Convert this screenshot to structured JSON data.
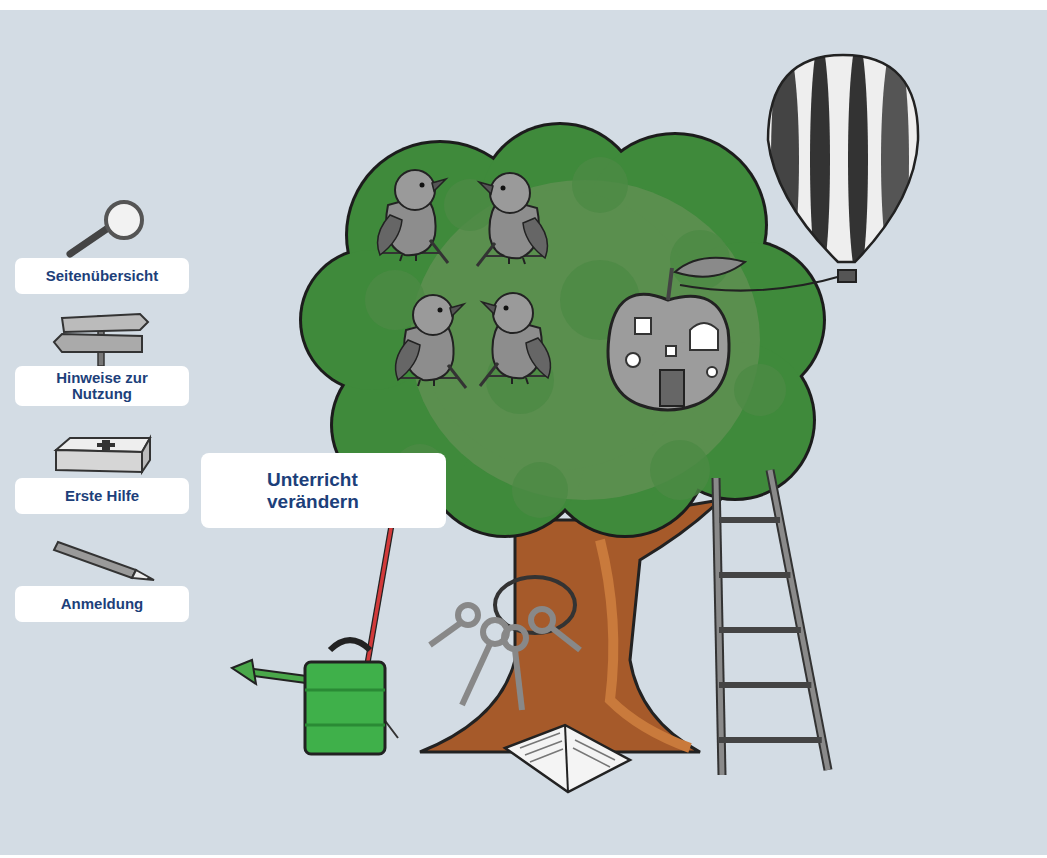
{
  "sidebar": {
    "items": [
      {
        "label": "Seitenübersicht"
      },
      {
        "label": "Hinweise zur Nutzung"
      },
      {
        "label": "Erste Hilfe"
      },
      {
        "label": "Anmeldung"
      }
    ]
  },
  "hotspot": {
    "label": "Unterricht verändern"
  }
}
